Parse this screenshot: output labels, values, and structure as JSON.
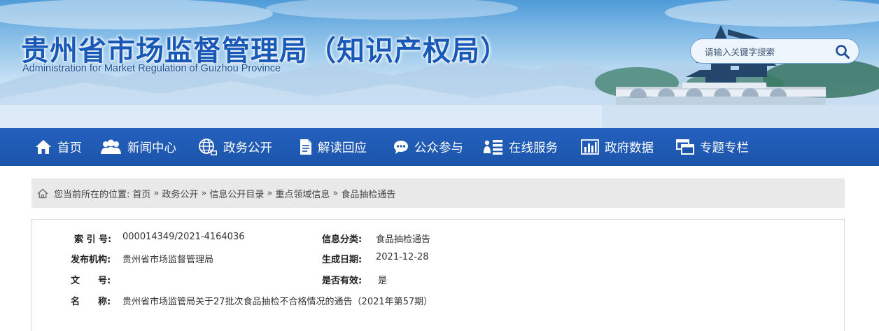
{
  "header": {
    "title": "贵州省市场监督管理局（知识产权局）",
    "subtitle": "Administration for Market Regulation of Guizhou Province",
    "search": {
      "placeholder": "请输入关键字搜索"
    }
  },
  "nav": {
    "items": [
      {
        "label": "首页",
        "icon": "home-icon"
      },
      {
        "label": "新闻中心",
        "icon": "people-icon"
      },
      {
        "label": "政务公开",
        "icon": "globe-icon"
      },
      {
        "label": "解读回应",
        "icon": "document-icon"
      },
      {
        "label": "公众参与",
        "icon": "chat-icon"
      },
      {
        "label": "在线服务",
        "icon": "list-icon"
      },
      {
        "label": "政府数据",
        "icon": "bar-chart-icon"
      },
      {
        "label": "专题专栏",
        "icon": "windows-icon"
      }
    ]
  },
  "breadcrumb": {
    "prefix": "您当前所在的位置:",
    "items": [
      "首页",
      "政务公开",
      "信息公开目录",
      "重点领域信息",
      "食品抽检通告"
    ],
    "separator": "»"
  },
  "info": {
    "index_label": "索 引 号:",
    "index_value": "000014349/2021-4164036",
    "category_label": "信息分类:",
    "category_value": "食品抽检通告",
    "publisher_label": "发布机构:",
    "publisher_value": "贵州省市场监督管理局",
    "date_label": "生成日期:",
    "date_value": "2021-12-28",
    "docno_label": "文　　号:",
    "docno_value": "",
    "valid_label": "是否有效:",
    "valid_value": "是",
    "name_label": "名　　称:",
    "name_value": "贵州省市场监管局关于27批次食品抽检不合格情况的通告（2021年第57期）"
  },
  "colors": {
    "nav_bg": "#1b54ab",
    "title_blue": "#1859b8",
    "breadcrumb_bg": "#e9e9e9"
  }
}
